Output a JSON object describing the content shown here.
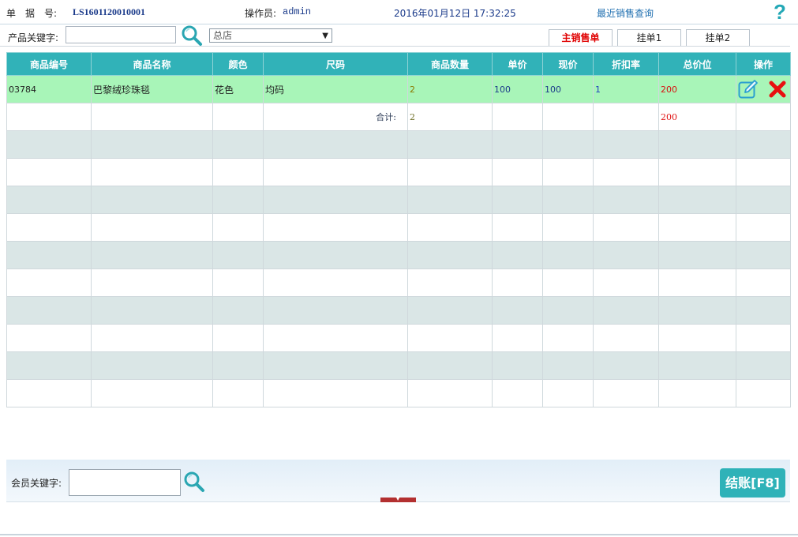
{
  "header": {
    "doc_label": "单　据　号:",
    "doc_no": "LS1601120010001",
    "operator_label": "操作员:",
    "operator": "admin",
    "datetime": "2016年01月12日 17:32:25",
    "recent_sales_link": "最近销售查询",
    "help_glyph": "?"
  },
  "search": {
    "keyword_label": "产品关键字:",
    "keyword_value": "",
    "store_selected": "总店"
  },
  "tabs": [
    {
      "label": "主销售单",
      "active": true
    },
    {
      "label": "挂单1",
      "active": false
    },
    {
      "label": "挂单2",
      "active": false
    }
  ],
  "table": {
    "columns": [
      "商品编号",
      "商品名称",
      "颜色",
      "尺码",
      "商品数量",
      "单价",
      "现价",
      "折扣率",
      "总价位",
      "操作"
    ],
    "rows": [
      {
        "code": "03784",
        "name": "巴黎绒珍珠毯",
        "color": "花色",
        "size": "均码",
        "qty": "2",
        "unit_price": "100",
        "current_price": "100",
        "discount": "1",
        "total": "200"
      }
    ],
    "summary": {
      "label": "合计:",
      "qty": "2",
      "total": "200"
    }
  },
  "footer": {
    "member_label": "会员关键字:",
    "member_value": "",
    "checkout_label": "结账[F8]"
  },
  "colors": {
    "accent": "#31b2b8",
    "selected_row": "#a8f5b8",
    "alt_row": "#dae6e6",
    "total_red": "#e01010"
  },
  "icons": {
    "help": "help-icon",
    "search": "search-icon",
    "edit": "edit-icon",
    "delete": "delete-icon",
    "dropdown": "chevron-down-icon"
  }
}
